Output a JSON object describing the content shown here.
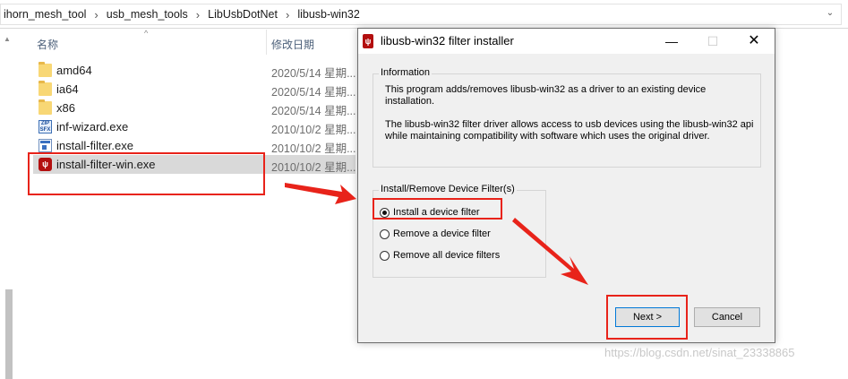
{
  "explorer": {
    "breadcrumbs": [
      "ihorn_mesh_tool",
      "usb_mesh_tools",
      "LibUsbDotNet",
      "libusb-win32"
    ],
    "columns": {
      "name": "名称",
      "date": "修改日期"
    },
    "files": [
      {
        "name": "amd64",
        "date": "2020/5/14 星期...",
        "icon": "folder-icon",
        "selected": false
      },
      {
        "name": "ia64",
        "date": "2020/5/14 星期...",
        "icon": "folder-icon",
        "selected": false
      },
      {
        "name": "x86",
        "date": "2020/5/14 星期...",
        "icon": "folder-icon",
        "selected": false
      },
      {
        "name": "inf-wizard.exe",
        "date": "2010/10/2 星期...",
        "icon": "zip-exe-icon",
        "selected": false
      },
      {
        "name": "install-filter.exe",
        "date": "2010/10/2 星期...",
        "icon": "exe-window-icon",
        "selected": false
      },
      {
        "name": "install-filter-win.exe",
        "date": "2010/10/2 星期...",
        "icon": "usb-installer-icon",
        "selected": true
      }
    ]
  },
  "dialog": {
    "title": "libusb-win32 filter installer",
    "info_group_title": "Information",
    "info_line1": "This program adds/removes libusb-win32 as a driver to an existing device",
    "info_line1b": "installation.",
    "info_line2": "The libusb-win32 filter driver allows access to usb devices using the libusb-win32 api",
    "info_line2b": "while maintaining compatibility with software which uses the original driver.",
    "filter_group_title": "Install/Remove Device Filter(s)",
    "options": [
      {
        "label": "Install a device filter",
        "checked": true
      },
      {
        "label": "Remove a device filter",
        "checked": false
      },
      {
        "label": "Remove all device filters",
        "checked": false
      }
    ],
    "next_label": "Next >",
    "cancel_label": "Cancel"
  },
  "watermark": "https://blog.csdn.net/sinat_23338865",
  "colors": {
    "highlight_red": "#e8231a",
    "selection": "#d9d9d9",
    "dialog_bg": "#f0f0f0"
  }
}
